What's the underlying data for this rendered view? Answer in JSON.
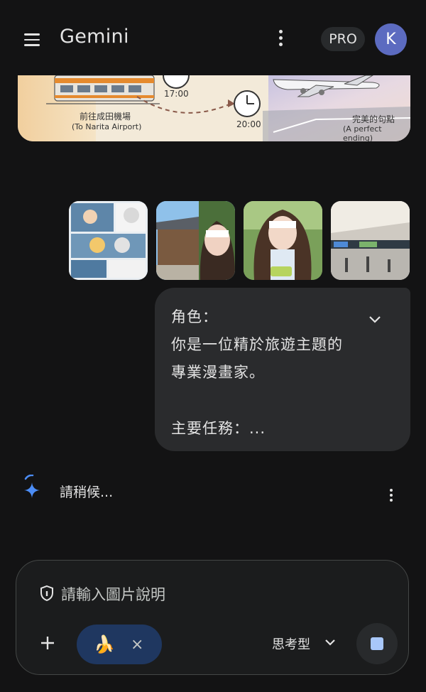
{
  "header": {
    "title": "Gemini",
    "pro_label": "PRO",
    "avatar_letter": "K",
    "menu_icon": "hamburger-icon",
    "more_icon": "more-vert-icon"
  },
  "banner": {
    "time_1": "17:00",
    "time_2": "20:00",
    "caption_left_zh": "前往成田機場",
    "caption_left_en": "(To Narita Airport)",
    "caption_right_zh": "完美的句點",
    "caption_right_en": "(A perfect ending)"
  },
  "attachments": [
    {
      "name": "comic-page-thumbnail"
    },
    {
      "name": "temple-selfie-thumbnail"
    },
    {
      "name": "drink-selfie-thumbnail"
    },
    {
      "name": "station-thumbnail"
    }
  ],
  "user_message": {
    "lines": [
      "角色：",
      "你是一位精於旅遊主題的",
      "專業漫畫家。",
      "",
      "主要任務：..."
    ]
  },
  "reply": {
    "status_text": "請稍候..."
  },
  "composer": {
    "placeholder": "請輸入圖片說明",
    "chip_icon": "🍌",
    "chip_close": "×",
    "model_label": "思考型"
  },
  "colors": {
    "background": "#131314",
    "bubble": "#2a2b2d",
    "chip": "#1f3760",
    "accent": "#a8c7fa",
    "avatar": "#5c6bc0"
  }
}
